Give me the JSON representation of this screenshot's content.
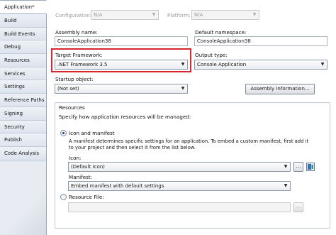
{
  "sidebar": {
    "items": [
      {
        "label": "Application*",
        "active": true
      },
      {
        "label": "Build"
      },
      {
        "label": "Build Events"
      },
      {
        "label": "Debug"
      },
      {
        "label": "Resources"
      },
      {
        "label": "Services"
      },
      {
        "label": "Settings"
      },
      {
        "label": "Reference Paths"
      },
      {
        "label": "Signing"
      },
      {
        "label": "Security"
      },
      {
        "label": "Publish"
      },
      {
        "label": "Code Analysis"
      }
    ]
  },
  "toolbar": {
    "configuration_label": "Configuration:",
    "configuration_value": "N/A",
    "platform_label": "Platform:",
    "platform_value": "N/A"
  },
  "assembly": {
    "name_label": "Assembly name:",
    "name_value": "ConsoleApplication38",
    "namespace_label": "Default namespace:",
    "namespace_value": "ConsoleApplication38"
  },
  "framework": {
    "label": "Target Framework:",
    "value": ".NET Framework 3.5"
  },
  "output": {
    "label": "Output type:",
    "value": "Console Application"
  },
  "startup": {
    "label": "Startup object:",
    "value": "(Not set)"
  },
  "assembly_info_button": "Assembly Information...",
  "resources": {
    "title": "Resources",
    "description": "Specify how application resources will be managed:",
    "icon_manifest_label": "Icon and manifest",
    "icon_manifest_desc": "A manifest determines specific settings for an application. To embed a custom manifest, first add it to your project and then select it from the list below.",
    "icon_label": "Icon:",
    "icon_value": "(Default Icon)",
    "browse_label": "...",
    "manifest_label": "Manifest:",
    "manifest_value": "Embed manifest with default settings",
    "resource_file_label": "Resource File:",
    "resource_file_value": ""
  }
}
